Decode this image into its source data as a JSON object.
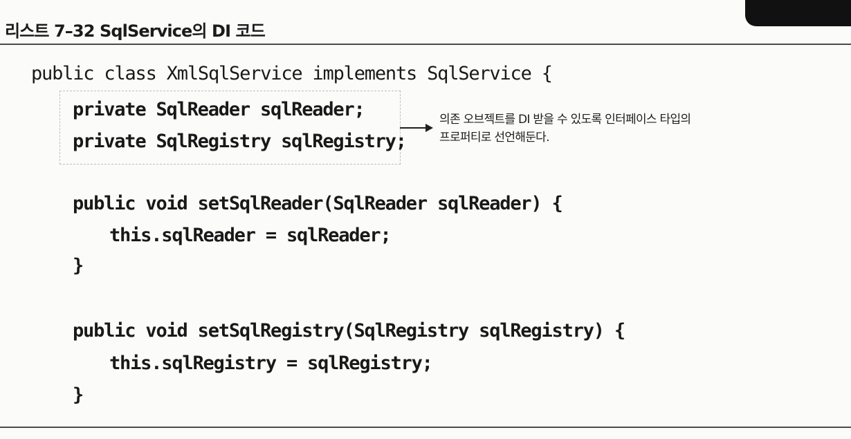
{
  "listing": {
    "title": "리스트 7–32 SqlService의 DI 코드"
  },
  "code": {
    "line1": "public class XmlSqlService implements SqlService {",
    "line2": "private SqlReader sqlReader;",
    "line3": "private SqlRegistry sqlRegistry;",
    "line4": "public void setSqlReader(SqlReader sqlReader) {",
    "line5": "this.sqlReader = sqlReader;",
    "line6": "}",
    "line7": "public void setSqlRegistry(SqlRegistry sqlRegistry) {",
    "line8": "this.sqlRegistry = sqlRegistry;",
    "line9": "}"
  },
  "annotation": {
    "line1": "의존 오브젝트를 DI 받을 수 있도록 인터페이스 타입의",
    "line2": "프로퍼티로 선언해둔다."
  },
  "colors": {
    "background": "#fbfbfa",
    "text": "#161616",
    "rule": "#4a4a4a",
    "dashed_border": "#bdbdbd",
    "corner_shape": "#111111"
  },
  "icons": {
    "annotation_arrow": "right-arrow-icon"
  }
}
